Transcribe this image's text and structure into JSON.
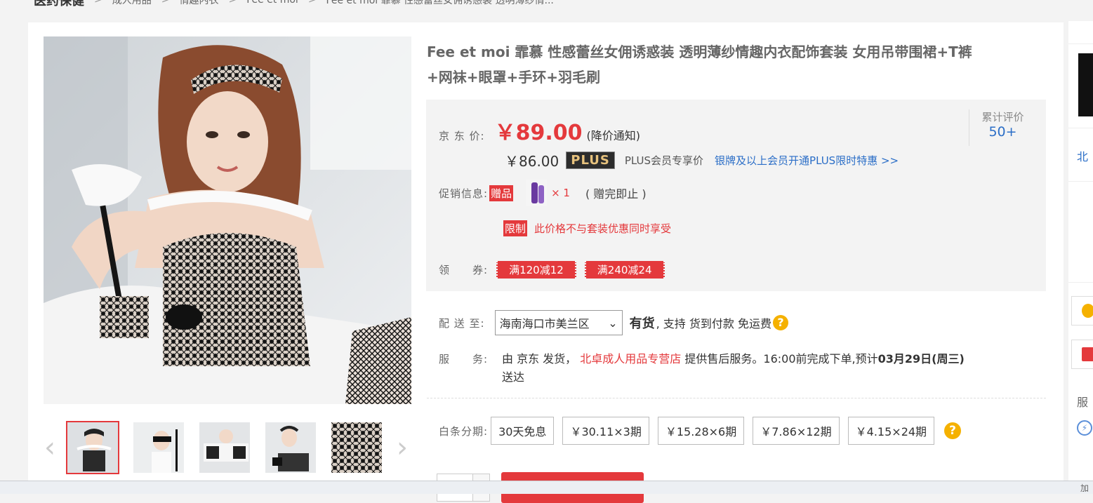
{
  "breadcrumb": {
    "root": "医药保健",
    "items": [
      "成人用品",
      "情趣内衣",
      "Fee et moi",
      "Fee et moi 霏慕 性感蕾丝女佣诱惑装 透明薄纱情..."
    ],
    "separator": ">"
  },
  "product": {
    "title": "Fee et moi 霏慕 性感蕾丝女佣诱惑装 透明薄纱情趣内衣配饰套装 女用吊带围裙+T裤+网袜+眼罩+手环+羽毛刷"
  },
  "gallery": {
    "prev_icon": "chevron-left-icon",
    "next_icon": "chevron-right-icon",
    "thumb_count": 5,
    "active_index": 0
  },
  "price": {
    "label": "京 东 价:",
    "value": "￥89.00",
    "notify": "(降价通知)",
    "plus_price": "￥86.00",
    "plus_badge": "PLUS",
    "plus_text": "PLUS会员专享价",
    "plus_link": "银牌及以上会员开通PLUS限时特惠 >>"
  },
  "reviews": {
    "label": "累计评价",
    "count": "50+"
  },
  "promo": {
    "label": "促销信息:",
    "gift_tag": "赠品",
    "gift_count": "× 1",
    "gift_note": "( 赠完即止 )",
    "limit_tag": "限制",
    "limit_text": "此价格不与套装优惠同时享受"
  },
  "coupons": {
    "label": "领　　券:",
    "items": [
      "满120减12",
      "满240减24"
    ]
  },
  "delivery": {
    "label": "配 送 至:",
    "region": "海南海口市美兰区",
    "stock": "有货",
    "tail": ", 支持 货到付款  免运费"
  },
  "service": {
    "label": "服　　务:",
    "prefix": "由 京东 发货，",
    "store": "北卓成人用品专营店",
    "middle": " 提供售后服务。16:00前完成下单,预计",
    "date": "03月29日(周三)",
    "suffix": "送达"
  },
  "installment": {
    "label": "白条分期:",
    "options": [
      "30天免息",
      "￥30.11×3期",
      "￥15.28×6期",
      "￥7.86×12期",
      "￥4.15×24期"
    ]
  },
  "rail": {
    "shop_char": "北",
    "service_char": "服"
  },
  "bottom_bar": {
    "text": "加"
  },
  "colors": {
    "accent": "#e4393c",
    "link": "#2b6ec7",
    "plus_gold": "#e7c27d"
  }
}
